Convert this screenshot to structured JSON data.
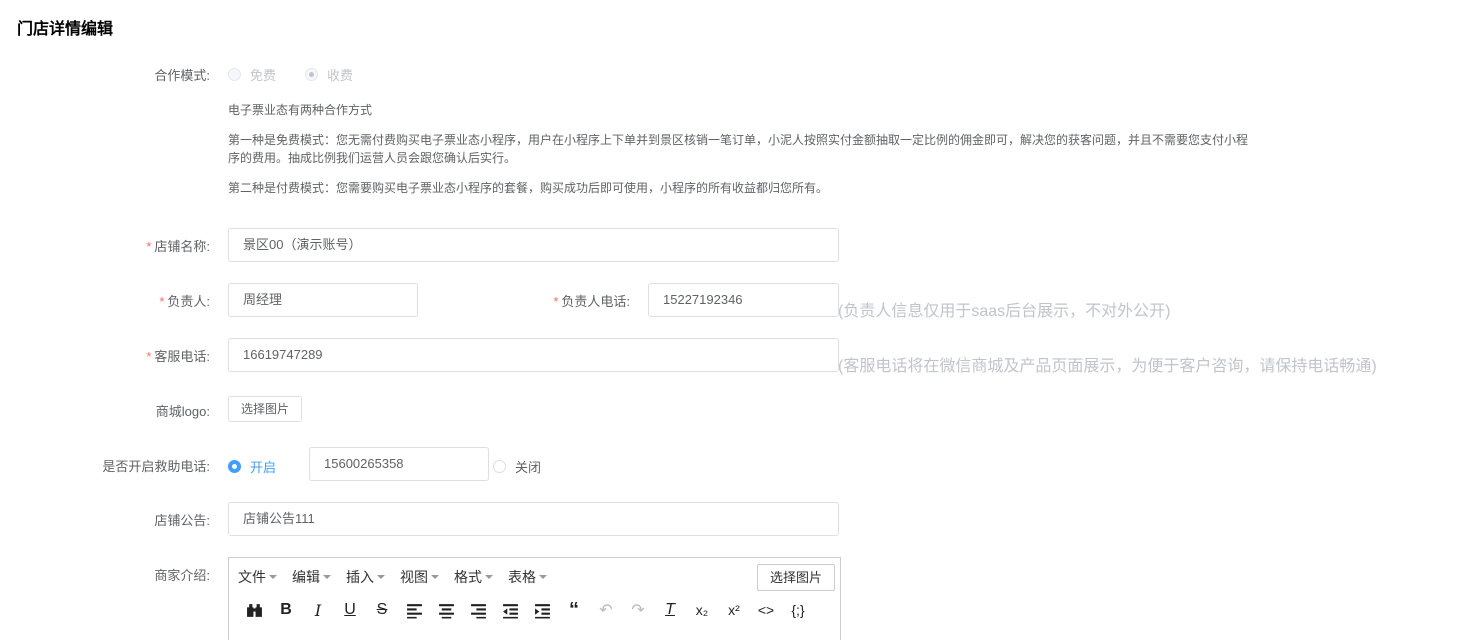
{
  "page": {
    "title": "门店详情编辑"
  },
  "cooperation": {
    "label": "合作模式:",
    "options": [
      {
        "label": "免费",
        "checked": false,
        "disabled": true
      },
      {
        "label": "收费",
        "checked": true,
        "disabled": true
      }
    ],
    "desc_title": "电子票业态有两种合作方式",
    "desc_free": "第一种是免费模式：您无需付费购买电子票业态小程序，用户在小程序上下单并到景区核销一笔订单，小泥人按照实付金额抽取一定比例的佣金即可，解决您的获客问题，并且不需要您支付小程序的费用。抽成比例我们运营人员会跟您确认后实行。",
    "desc_paid": "第二种是付费模式：您需要购买电子票业态小程序的套餐，购买成功后即可使用，小程序的所有收益都归您所有。"
  },
  "shop_name": {
    "label": "店铺名称:",
    "value": "景区00（演示账号）"
  },
  "manager": {
    "label": "负责人:",
    "value": "周经理"
  },
  "manager_phone": {
    "label": "负责人电话:",
    "value": "15227192346",
    "hint": "(负责人信息仅用于saas后台展示，不对外公开)"
  },
  "service_phone": {
    "label": "客服电话:",
    "value": "16619747289",
    "hint": "(客服电话将在微信商城及产品页面展示，为便于客户咨询，请保持电话畅通)"
  },
  "logo": {
    "label": "商城logo:",
    "button": "选择图片"
  },
  "rescue": {
    "label": "是否开启救助电话:",
    "on_label": "开启",
    "value": "15600265358",
    "off_label": "关闭",
    "selected": "on"
  },
  "notice": {
    "label": "店铺公告:",
    "value": "店铺公告111"
  },
  "intro": {
    "label": "商家介绍:",
    "menus": [
      "文件",
      "编辑",
      "插入",
      "视图",
      "格式",
      "表格"
    ],
    "select_image": "选择图片",
    "tools": [
      "binoculars-icon",
      "bold-icon",
      "italic-icon",
      "underline-icon",
      "strikethrough-icon",
      "align-left-icon",
      "align-center-icon",
      "align-right-icon",
      "outdent-icon",
      "indent-icon",
      "blockquote-icon",
      "undo-icon",
      "redo-icon",
      "remove-format-icon",
      "subscript-icon",
      "superscript-icon",
      "code-icon",
      "code-sample-icon"
    ]
  }
}
